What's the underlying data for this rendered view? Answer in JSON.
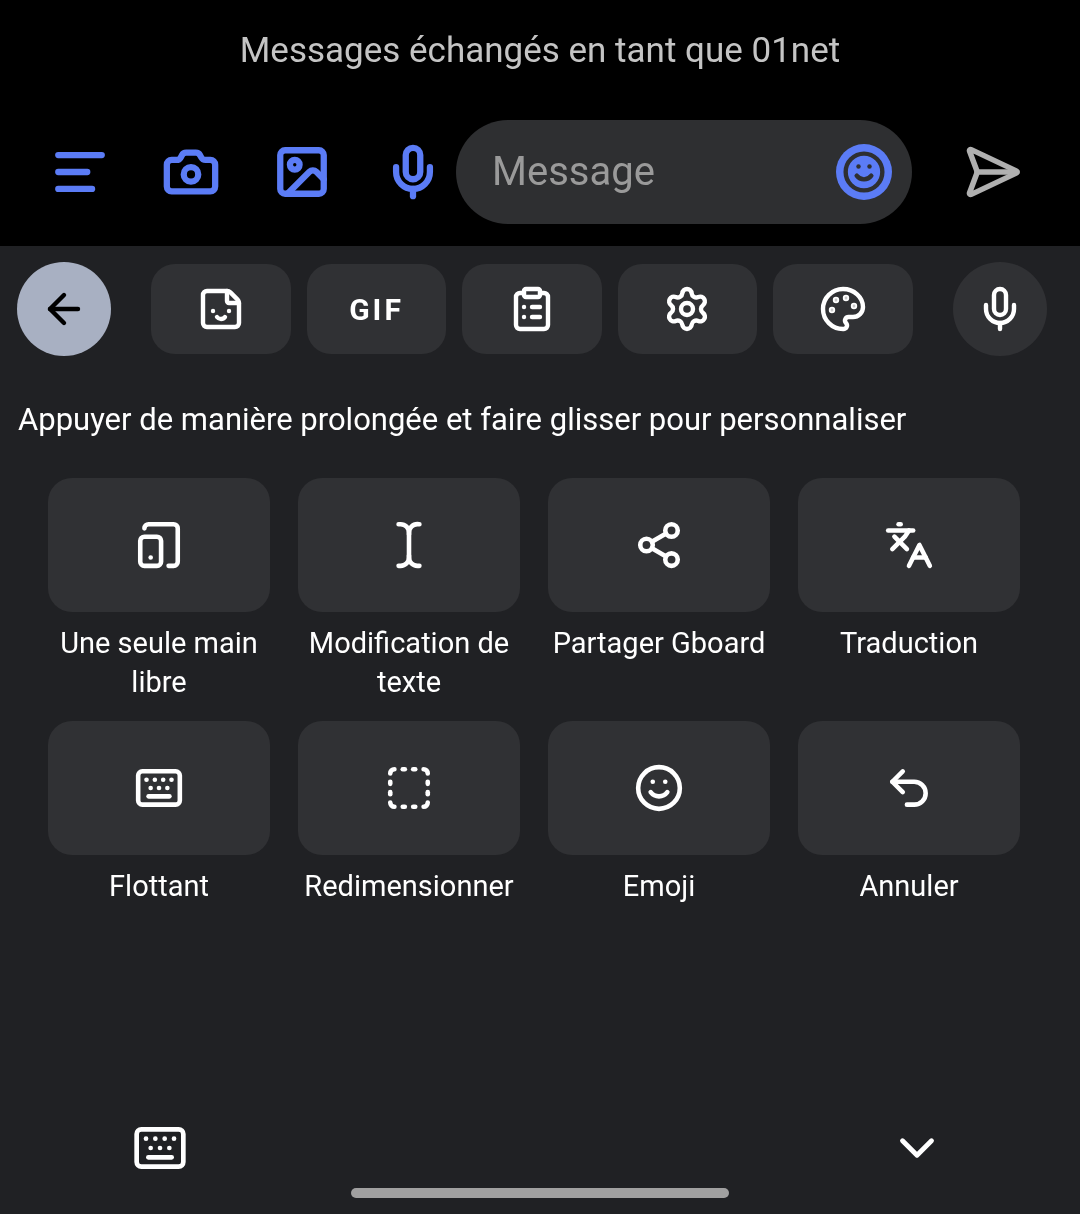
{
  "header": {
    "subtitle": "Messages échangés en tant que 01net"
  },
  "compose": {
    "actions": [
      {
        "kind": "format"
      },
      {
        "kind": "camera"
      },
      {
        "kind": "gallery"
      },
      {
        "kind": "voice"
      }
    ],
    "placeholder": "Message"
  },
  "toolbar": [
    {
      "kind": "back",
      "selected": true
    },
    {
      "kind": "sticker",
      "selected": false
    },
    {
      "kind": "gif",
      "label": "GIF",
      "selected": false
    },
    {
      "kind": "clipboard",
      "selected": false
    },
    {
      "kind": "settings",
      "selected": false
    },
    {
      "kind": "theme",
      "selected": false
    },
    {
      "kind": "mic",
      "selected": false
    }
  ],
  "hint": "Appuyer de manière prolongée et faire glisser pour personnaliser",
  "tiles": [
    {
      "kind": "one-hand",
      "label": "Une seule main libre"
    },
    {
      "kind": "text-edit",
      "label": "Modification de texte"
    },
    {
      "kind": "share",
      "label": "Partager Gboard"
    },
    {
      "kind": "translate",
      "label": "Traduction"
    },
    {
      "kind": "floating",
      "label": "Flottant"
    },
    {
      "kind": "resize",
      "label": "Redimensionner"
    },
    {
      "kind": "emoji",
      "label": "Emoji"
    },
    {
      "kind": "undo",
      "label": "Annuler"
    }
  ]
}
